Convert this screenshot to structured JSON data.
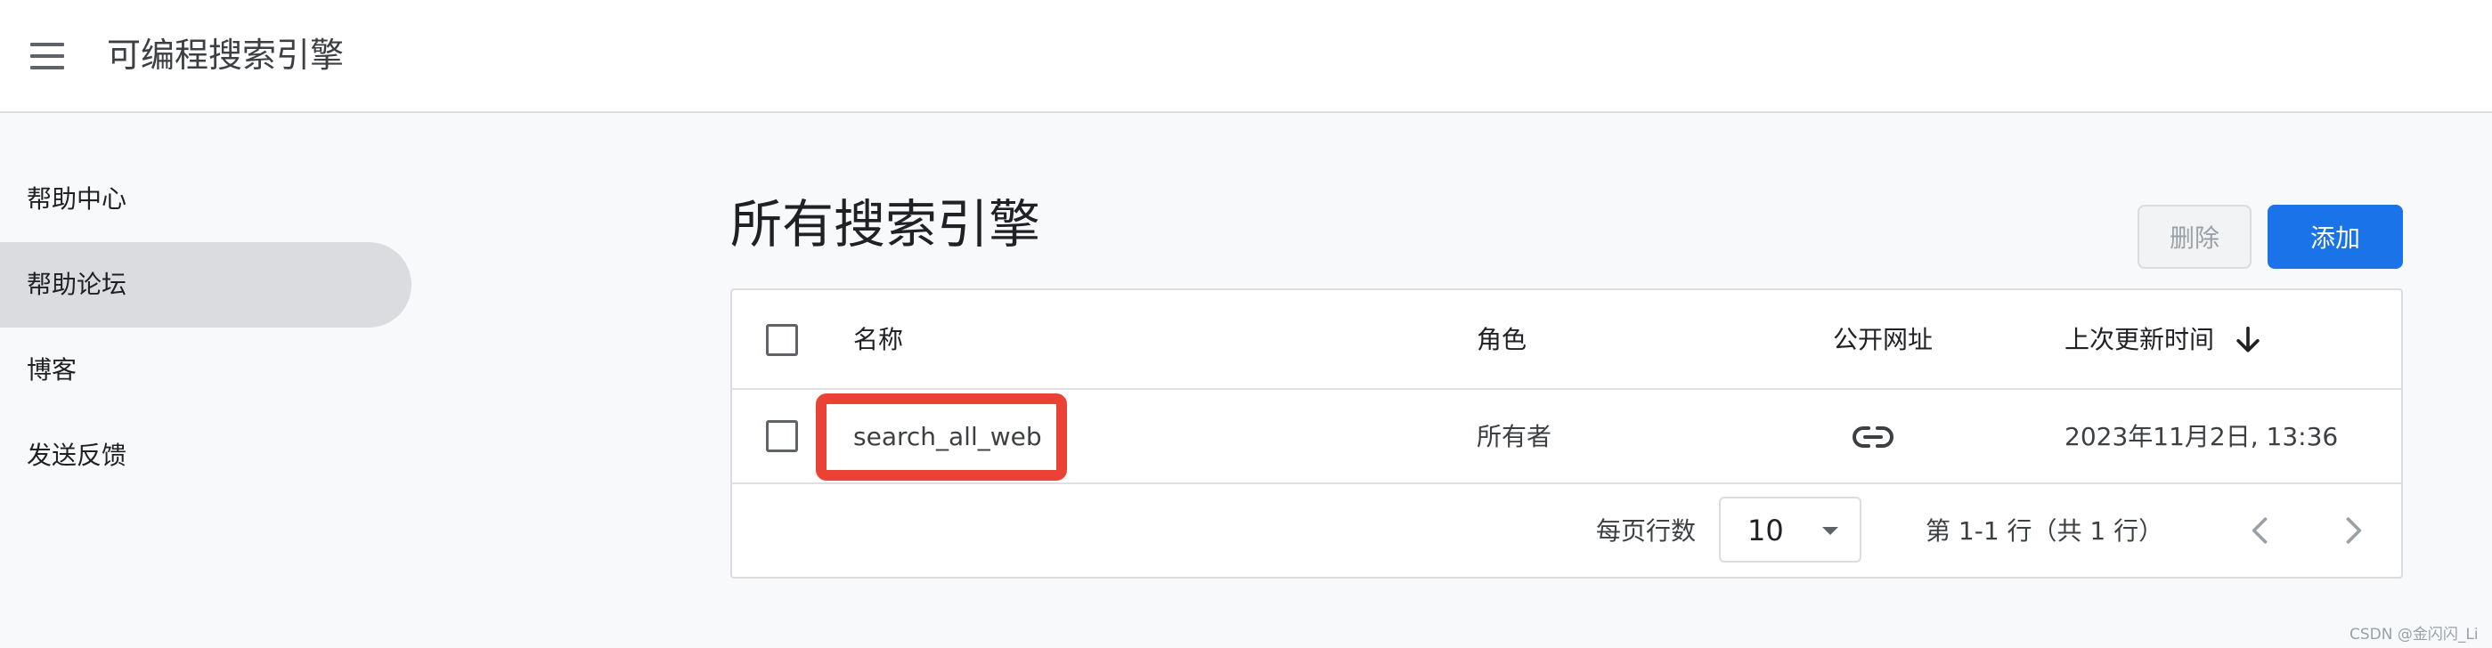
{
  "header": {
    "app_title": "可编程搜索引擎",
    "menu_icon": "menu-icon"
  },
  "sidebar": {
    "items": [
      {
        "label": "帮助中心"
      },
      {
        "label": "帮助论坛",
        "active": true
      },
      {
        "label": "博客"
      },
      {
        "label": "发送反馈"
      }
    ]
  },
  "main": {
    "heading": "所有搜索引擎",
    "delete_label": "删除",
    "add_label": "添加",
    "table": {
      "columns": {
        "name": "名称",
        "role": "角色",
        "public_url": "公开网址",
        "last_updated": "上次更新时间"
      },
      "sort_icon": "arrow-down-icon",
      "rows": [
        {
          "name": "search_all_web",
          "role": "所有者",
          "public_url_icon": "link-icon",
          "last_updated": "2023年11月2日, 13:36"
        }
      ],
      "footer": {
        "rows_per_page_label": "每页行数",
        "rows_per_page_value": "10",
        "range_label": "第 1-1 行（共 1 行）"
      }
    }
  },
  "watermark": "CSDN @金闪闪_Li",
  "colors": {
    "accent": "#1a73e8",
    "highlight": "#ea4335"
  }
}
